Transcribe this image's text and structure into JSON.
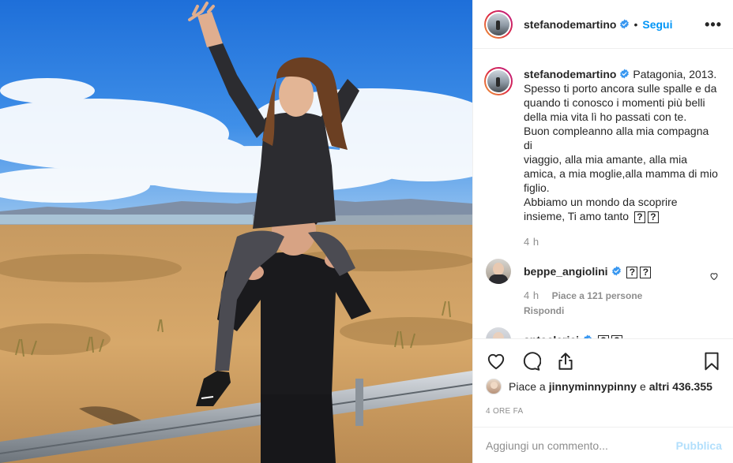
{
  "post": {
    "username": "stefanodemartino",
    "verified": true,
    "separator": "•",
    "follow_label": "Segui",
    "more_label": "•••"
  },
  "caption": {
    "username": "stefanodemartino",
    "lines": [
      "Patagonia, 2013.",
      "Spesso ti porto ancora sulle spalle e da",
      "quando ti conosco i momenti più belli",
      "della mia vita lì ho passati con te.",
      "Buon compleanno alla mia compagna di",
      "viaggio, alla mia amante, alla mia",
      "amica, a mia moglie,alla mamma di mio",
      "figlio.",
      "Abbiamo un mondo da scoprire",
      "insieme, Ti amo tanto"
    ],
    "time": "4 h"
  },
  "comments": [
    {
      "username": "beppe_angiolini",
      "verified": true,
      "time": "4 h",
      "likes": "Piace a 121 persone",
      "reply": "Rispondi"
    },
    {
      "username": "antoclerici",
      "verified": true
    }
  ],
  "emoji_placeholder": "?",
  "likes": {
    "prefix": "Piace a",
    "user": "jinnyminnypinny",
    "conj": "e",
    "others": "altri 436.355"
  },
  "post_time": "4 ORE FA",
  "add_comment": {
    "placeholder": "Aggiungi un commento...",
    "publish_label": "Pubblica"
  },
  "colors": {
    "link_blue": "#0095f6",
    "publish_disabled": "#b2dffc",
    "verified_blue": "#3897f0",
    "muted": "#8e8e8e"
  },
  "icons": [
    "heart-icon",
    "comment-icon",
    "share-icon",
    "bookmark-icon",
    "verified-badge-icon",
    "more-options-icon"
  ]
}
